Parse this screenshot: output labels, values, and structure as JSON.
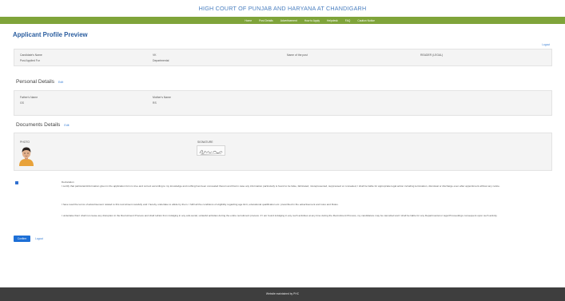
{
  "header": {
    "title": "HIGH COURT OF PUNJAB AND HARYANA AT CHANDIGARH"
  },
  "nav": [
    "Home",
    "Post Details",
    "Advertisement",
    "How to Apply",
    "Helpdesk",
    "FAQ",
    "Caution Notice"
  ],
  "page": {
    "heading": "Applicant Profile Preview",
    "logout_top": "Logout"
  },
  "profile": {
    "candidate_name_label": "Candidate's Name",
    "candidate_name_value": "VK",
    "post_name_label": "Name of the post",
    "post_name_value": "READER (LEGAL)",
    "post_applied_label": "Post Applied For",
    "post_applied_value": "Departmental"
  },
  "personal": {
    "title": "Personal Details",
    "edit": "Edit",
    "father_label": "Father's Name",
    "father_value": "GS",
    "mother_label": "Mother's Name",
    "mother_value": "RS"
  },
  "documents": {
    "title": "Documents Details",
    "edit": "Edit",
    "photo_label": "PHOTO",
    "signature_label": "SIGNATURE"
  },
  "declaration": {
    "title": "Declaration",
    "para1": "I certify that particulars/information given in the application form is true and correct according to my knowledge and nothing has been concealed therein and that in case any information particularly is found to be false, fabricated, misrepresented, suppressed or concealed, I shall be liable for appropriate legal action including termination, dismissal or discharge even after appointment without any notice.",
    "para2": "I have read the terms of advertisement related to this recruitment carefully and I hereby undertake to abide by them. I fulfil all the conditions of eligibility regarding age limit, educational qualification etc. prescribed in the advertisement and rules and Rules.",
    "para3": "I undertake that I shall not cause any disruption in the Recruitment Process and shall refrain from indulging in any anti-social, unlawful activities during the entire recruitment process. If I am found indulging in any such activities at any time during the Recruitment Process, my candidature may be cancelled and I shall be liable for any Departmental or legal Proceedings consequent upon such activity."
  },
  "actions": {
    "confirm": "Confirm",
    "logout": "Logout"
  },
  "footer": {
    "text": "Website maintained by PHC"
  }
}
